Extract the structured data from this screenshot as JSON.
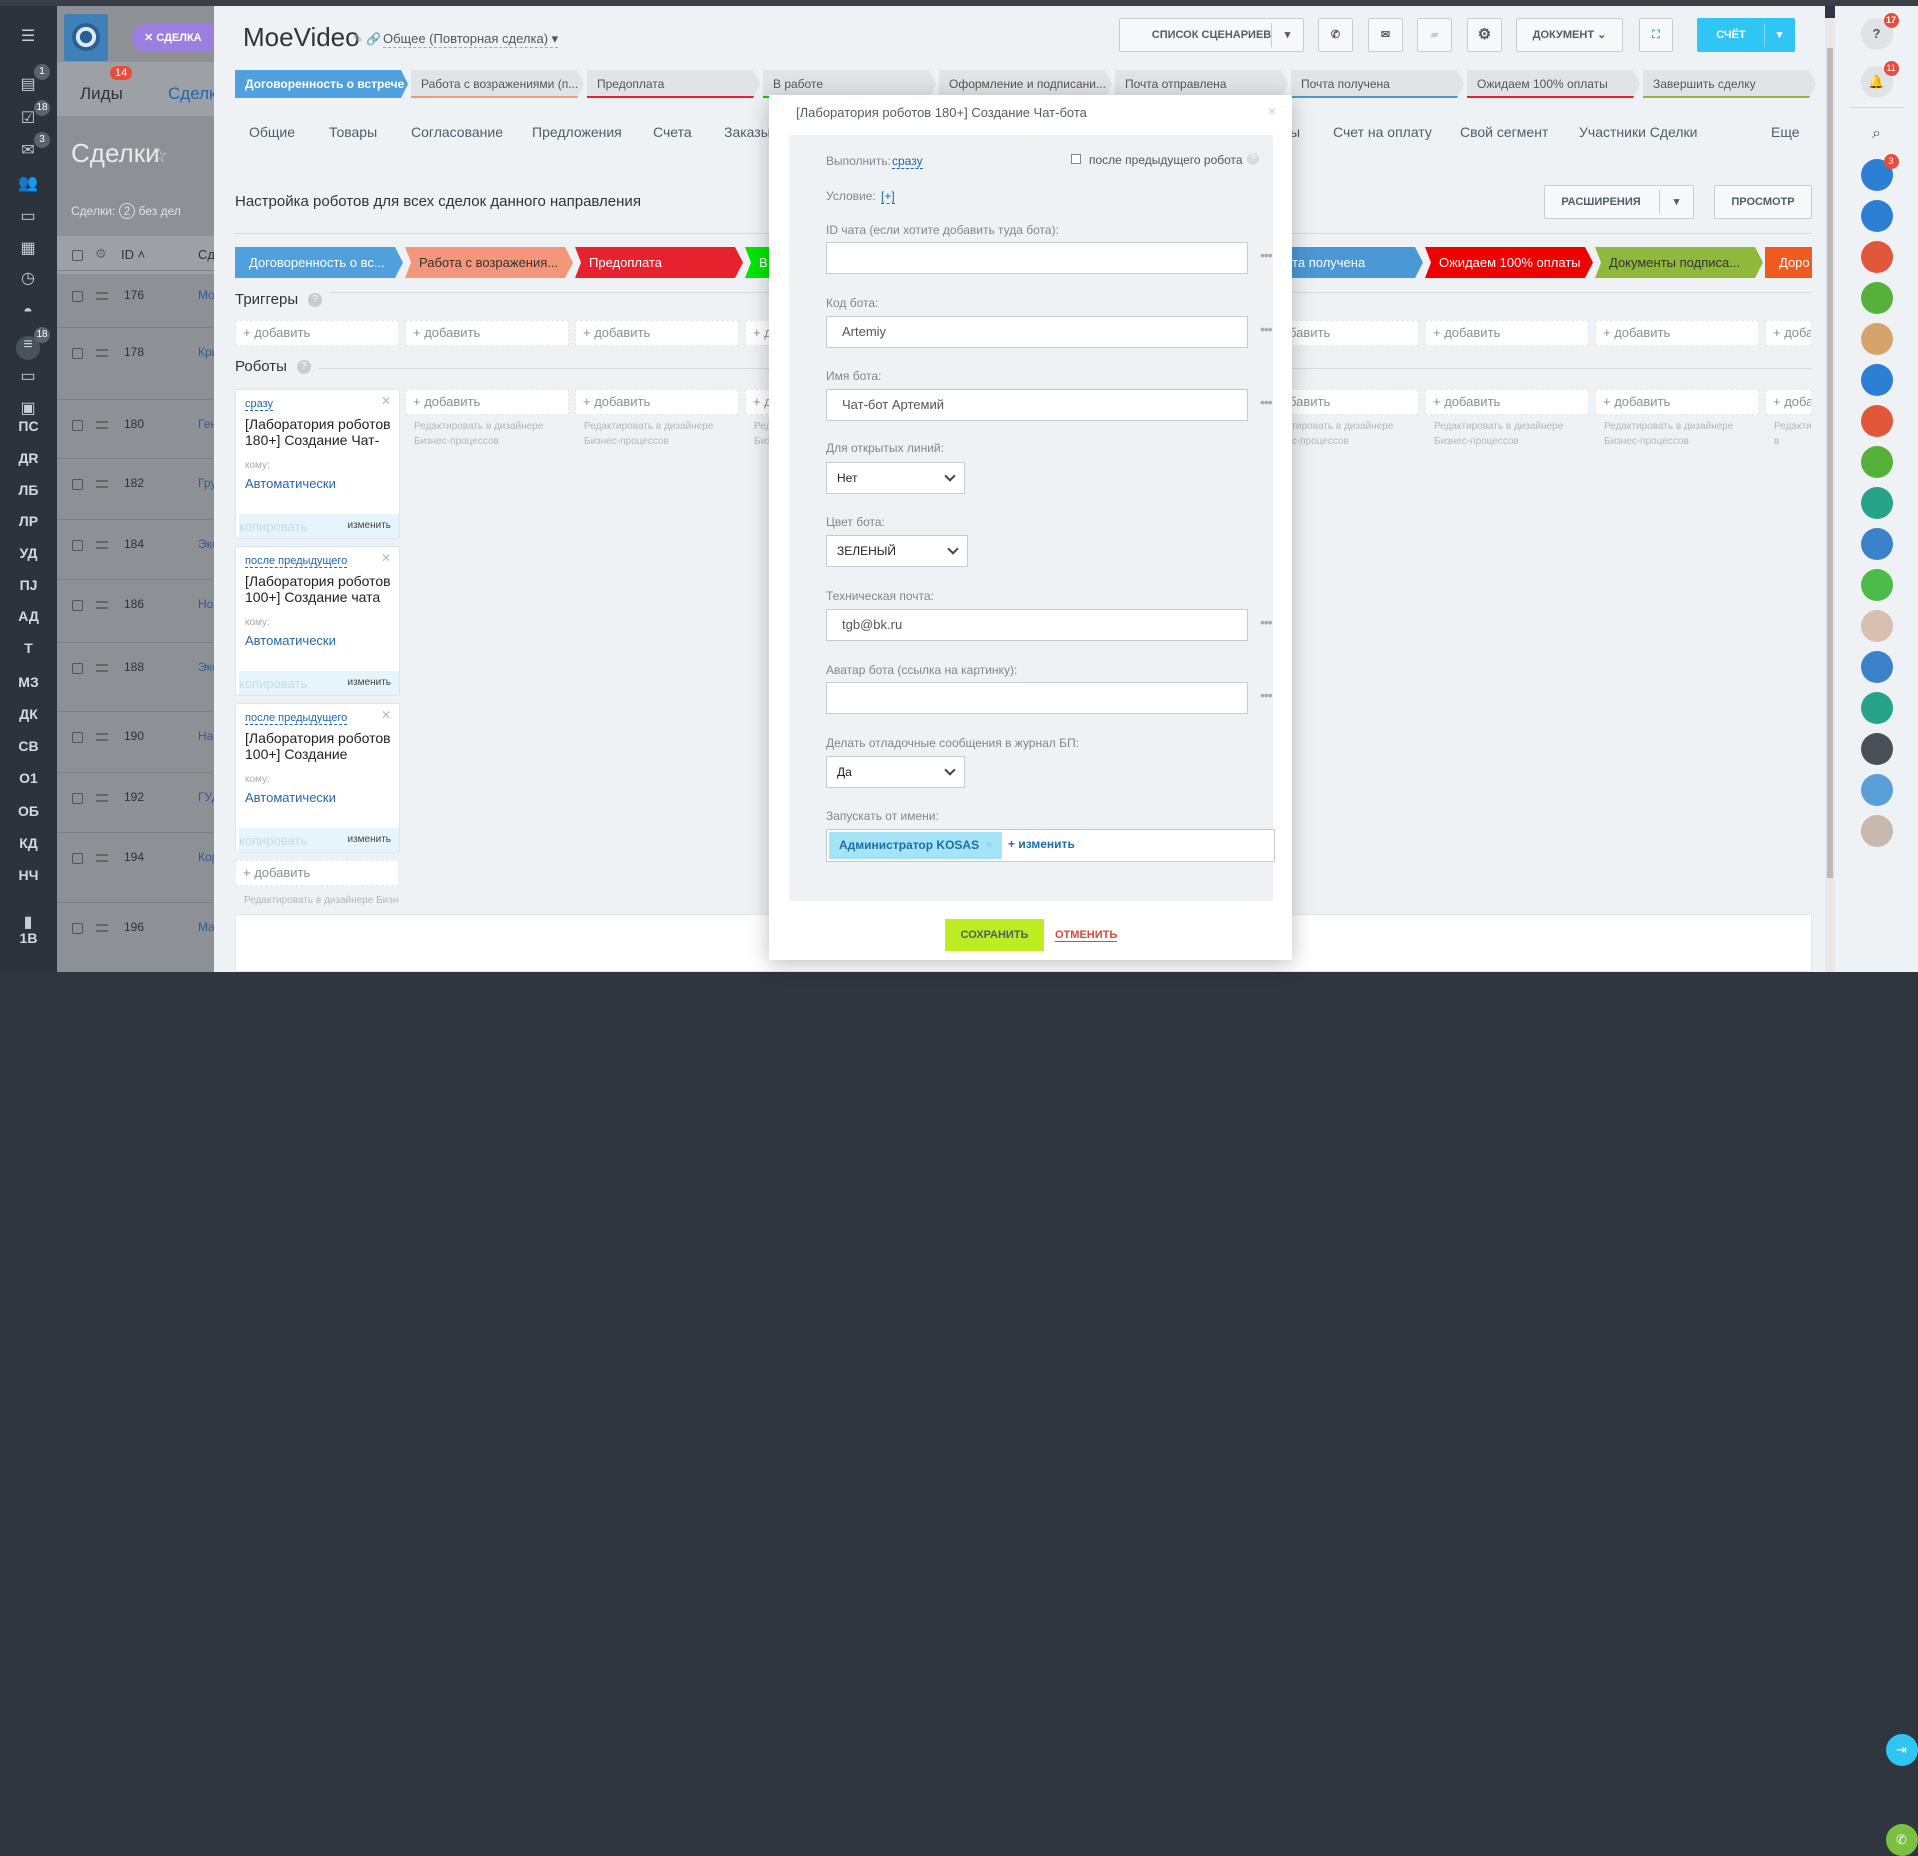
{
  "left_nav": {
    "badges": {
      "tasks": "1",
      "check": "18",
      "chat": "3",
      "filter": "18"
    },
    "labels": [
      "ПС",
      "ДR",
      "ЛБ",
      "ЛР",
      "УД",
      "ПJ",
      "АД",
      "Т",
      "МЗ",
      "ДК",
      "СВ",
      "О1",
      "ОБ",
      "КД",
      "НЧ",
      "1В"
    ]
  },
  "list": {
    "chip": "СДЕЛКА",
    "tab_leads": "Лиды",
    "leads_badge": "14",
    "tab_deals": "Сделки",
    "title": "Сделки",
    "filter_label": "Сделки:",
    "filter_count": "2",
    "filter_suffix": "без дел",
    "col_id": "ID",
    "col_name": "Сд",
    "rows": [
      {
        "id": "176",
        "name": "Мо"
      },
      {
        "id": "178",
        "name": "Кри"
      },
      {
        "id": "180",
        "name": "Ген"
      },
      {
        "id": "182",
        "name": "Гру"
      },
      {
        "id": "184",
        "name": "Экс"
      },
      {
        "id": "186",
        "name": "Нор"
      },
      {
        "id": "188",
        "name": "Экс"
      },
      {
        "id": "190",
        "name": "Нас"
      },
      {
        "id": "192",
        "name": "ГУД"
      },
      {
        "id": "194",
        "name": "Кор"
      },
      {
        "id": "196",
        "name": "Мау"
      }
    ]
  },
  "deal": {
    "title": "MoeVideo",
    "category": "Общее (Повторная сделка)",
    "buttons": {
      "scenarios": "СПИСОК СЦЕНАРИЕВ",
      "document": "ДОКУМЕНТ",
      "invoice": "СЧЁТ",
      "extensions": "РАСШИРЕНИЯ",
      "preview": "ПРОСМОТР"
    },
    "stages": [
      {
        "label": "Договоренность о встрече",
        "line": "#4fa0dc"
      },
      {
        "label": "Работа с возражениями (п...",
        "line": "#f4967a"
      },
      {
        "label": "Предоплата",
        "line": "#e8212e"
      },
      {
        "label": "В работе",
        "line": "#00d000"
      },
      {
        "label": "Оформление и подписани...",
        "line": "#e1e4e7"
      },
      {
        "label": "Почта отправлена",
        "line": "#e1e4e7"
      },
      {
        "label": "Почта получена",
        "line": "#4a98d6"
      },
      {
        "label": "Ожидаем 100% оплаты",
        "line": "#e8212e"
      },
      {
        "label": "Завершить сделку",
        "line": "#8fb93a"
      }
    ],
    "tabs": [
      "Общие",
      "Товары",
      "Согласование",
      "Предложения",
      "Счета",
      "Заказы",
      "ы",
      "Счет на оплату",
      "Свой сегмент",
      "Участники Сделки",
      "Еще"
    ],
    "robots_title": "Настройка роботов для всех сделок данного направления",
    "pipeline": [
      {
        "label": "Договоренность о вс...",
        "color": "#4fa0dc"
      },
      {
        "label": "Работа с возражения...",
        "color": "#f4967a",
        "text": "#333"
      },
      {
        "label": "Предоплата",
        "color": "#e8212e"
      },
      {
        "label": "В",
        "color": "#00e600"
      },
      {
        "label": "",
        "color": "#cccccc"
      },
      {
        "label": "",
        "color": "#cccccc"
      },
      {
        "label": "Почта получена",
        "color": "#4a98d6"
      },
      {
        "label": "Ожидаем 100% оплаты",
        "color": "#f00000"
      },
      {
        "label": "Документы подписа...",
        "color": "#8fb93a",
        "text": "#333"
      },
      {
        "label": "Доро",
        "color": "#f05a1e"
      }
    ],
    "triggers_label": "Триггеры",
    "robots_label": "Роботы",
    "add": "+ добавить",
    "edit_bp": "Редактировать в дизайнере Бизнес-процессов",
    "robot_cards": [
      {
        "when": "сразу",
        "title": "[Лаборатория роботов 180+] Создание Чат-",
        "to": "кому:",
        "resp": "Автоматически",
        "copy": "копировать",
        "change": "изменить"
      },
      {
        "when": "после предыдущего",
        "title": "[Лаборатория роботов 100+] Создание чата",
        "to": "кому:",
        "resp": "Автоматически",
        "copy": "копировать",
        "change": "изменить"
      },
      {
        "when": "после предыдущего",
        "title": "[Лаборатория роботов 100+] Создание",
        "to": "кому:",
        "resp": "Автоматически",
        "copy": "копировать",
        "change": "изменить"
      }
    ]
  },
  "modal": {
    "title": "[Лаборатория роботов 180+] Создание Чат-бота",
    "execute_label": "Выполнить:",
    "execute_value": "сразу",
    "after_prev": "после предыдущего робота",
    "condition_label": "Условие:",
    "condition_value": "[+]",
    "chat_id_label": "ID чата (если хотите добавить туда бота):",
    "chat_id_value": "",
    "bot_code_label": "Код бота:",
    "bot_code_value": "Artemiy",
    "bot_name_label": "Имя бота:",
    "bot_name_value": "Чат-бот Артемий",
    "open_lines_label": "Для открытых линий:",
    "open_lines_value": "Нет",
    "color_label": "Цвет бота:",
    "color_value": "ЗЕЛЕНЫЙ",
    "email_label": "Техническая почта:",
    "email_value": "tgb@bk.ru",
    "avatar_label": "Аватар бота (ссылка на картинку):",
    "avatar_value": "",
    "debug_label": "Делать отладочные сообщения в журнал БП:",
    "debug_value": "Да",
    "run_as_label": "Запускать от имени:",
    "run_as_value": "Администратор KOSAS",
    "run_as_change": "+ изменить",
    "save": "СОХРАНИТЬ",
    "cancel": "ОТМЕНИТЬ"
  },
  "right_bar": {
    "help_badge": "17",
    "bell_badge": "11",
    "items": [
      {
        "icon": "robot-avatar",
        "color": "#2d7fd3",
        "badge": "3"
      },
      {
        "icon": "robot-avatar",
        "color": "#2d7fd3"
      },
      {
        "icon": "crm-avatar",
        "color": "#e0573b"
      },
      {
        "icon": "crm-avatar",
        "color": "#56b13a"
      },
      {
        "icon": "people-avatar",
        "color": "#d6a46b"
      },
      {
        "icon": "robot-avatar",
        "color": "#2d7fd3"
      },
      {
        "icon": "crm-avatar",
        "color": "#e0573b"
      },
      {
        "icon": "crm-avatar",
        "color": "#56b13a"
      },
      {
        "icon": "user-avatar",
        "color": "#27a38a"
      },
      {
        "icon": "group-avatar",
        "color": "#3b82c9"
      },
      {
        "icon": "user-avatar",
        "color": "#4cbb4a"
      },
      {
        "icon": "photo-avatar",
        "color": "#d8c0b0"
      },
      {
        "icon": "group-avatar",
        "color": "#3b82c9"
      },
      {
        "icon": "user-avatar",
        "color": "#27a38a"
      },
      {
        "icon": "photo-avatar",
        "color": "#4a5058"
      },
      {
        "icon": "gear-avatar",
        "color": "#5a9fd8"
      },
      {
        "icon": "photo-avatar",
        "color": "#c9b8ae"
      }
    ],
    "transfer_color": "#2fc6f6",
    "call_color": "#7ac143"
  }
}
